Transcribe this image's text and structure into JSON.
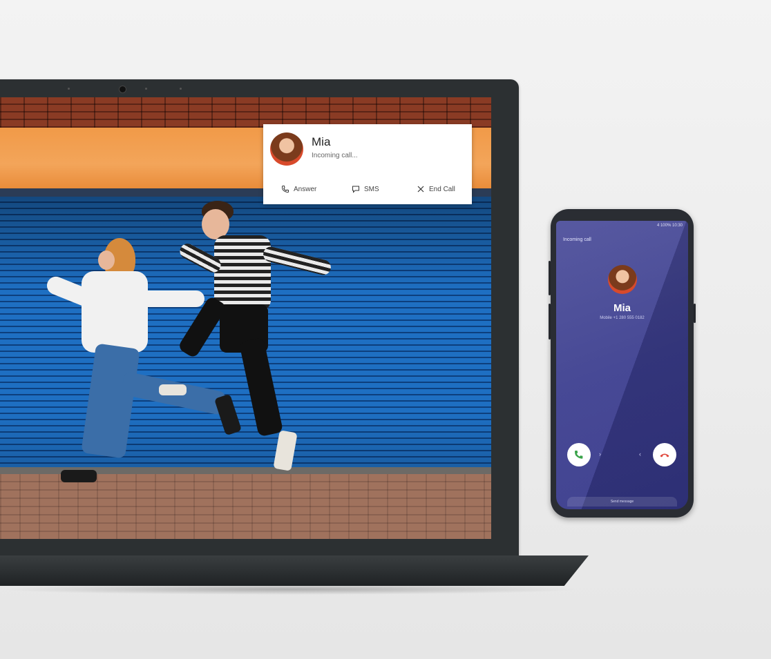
{
  "notification": {
    "caller_name": "Mia",
    "subtitle": "Incoming call...",
    "actions": {
      "answer": "Answer",
      "sms": "SMS",
      "end_call": "End Call"
    },
    "icons": {
      "answer": "phone-icon",
      "sms": "message-icon",
      "end_call": "close-icon"
    }
  },
  "phone": {
    "status_text": "4 100% 10:30",
    "title": "Incoming call",
    "caller_name": "Mia",
    "caller_number": "Mobile +1 280 555 0182",
    "bottom_label": "Send message",
    "colors": {
      "accept": "#3aa34a",
      "decline": "#e0453a",
      "screen": "#3c3e8f"
    }
  },
  "colors": {
    "shutter_blue": "#1e6fc2",
    "orange_band": "#f19a48",
    "laptop_body": "#2c3032"
  }
}
